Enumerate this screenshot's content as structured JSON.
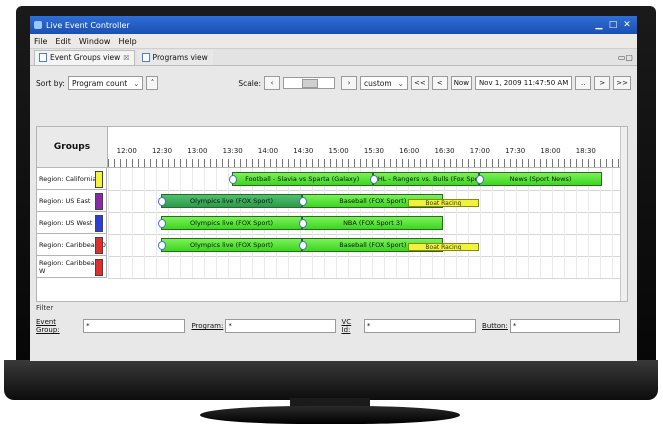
{
  "window": {
    "title": "Live Event Controller"
  },
  "menu": [
    "File",
    "Edit",
    "Window",
    "Help"
  ],
  "tabs": [
    {
      "label": "Event Groups view",
      "marker": "☒"
    },
    {
      "label": "Programs view"
    }
  ],
  "toolbar": {
    "sort_label": "Sort by:",
    "sort_value": "Program count",
    "scale_label": "Scale:",
    "scale_mode": "custom",
    "nav": [
      "<<",
      "<",
      "Now"
    ],
    "datetime": "Nov 1, 2009 11:47:50 AM",
    "nav_after": [
      "..",
      ">",
      ">>"
    ]
  },
  "grid": {
    "groups_header": "Groups",
    "times": [
      "12:00",
      "12:30",
      "13:00",
      "13:30",
      "14:00",
      "14:30",
      "15:00",
      "15:30",
      "16:00",
      "16:30",
      "17:00",
      "17:30",
      "18:00",
      "18:30"
    ],
    "rows": [
      {
        "label": "Region: California",
        "color": "#f4f43a",
        "events": [
          {
            "title": "Football - Slavia vs Sparta (Galaxy)",
            "kind": "green",
            "start": "13:30",
            "end": "15:30"
          },
          {
            "title": "NHL - Rangers vs. Bulls (Fox Spo",
            "kind": "green",
            "start": "15:30",
            "end": "17:00"
          },
          {
            "title": "News (Sport News)",
            "kind": "green",
            "start": "17:00",
            "end": "18:45"
          }
        ]
      },
      {
        "label": "Region: US East",
        "color": "#8a2aa8",
        "events": [
          {
            "title": "Olympics live (FOX Sport)",
            "kind": "darkgreen",
            "start": "12:30",
            "end": "14:30"
          },
          {
            "title": "Baseball (FOX Sport)",
            "kind": "green",
            "start": "14:30",
            "end": "16:30"
          },
          {
            "title": "Boat Racing",
            "kind": "yellow",
            "start": "16:00",
            "end": "17:00"
          }
        ]
      },
      {
        "label": "Region: US West",
        "color": "#2b3fd6",
        "events": [
          {
            "title": "Olympics live (FOX Sport)",
            "kind": "green",
            "start": "12:30",
            "end": "14:30"
          },
          {
            "title": "NBA (FOX Sport 3)",
            "kind": "green",
            "start": "14:30",
            "end": "16:30"
          }
        ]
      },
      {
        "label": "Region: Caribbean D",
        "color": "#e32d2d",
        "events": [
          {
            "title": "Olympics live (FOX Sport)",
            "kind": "green",
            "start": "12:30",
            "end": "14:30"
          },
          {
            "title": "Baseball (FOX Sport)",
            "kind": "green",
            "start": "14:30",
            "end": "16:30"
          },
          {
            "title": "Boat Racing",
            "kind": "yellow",
            "start": "16:00",
            "end": "17:00"
          }
        ]
      },
      {
        "label": "Region: Caribbean W",
        "color": "#e32d2d",
        "events": []
      }
    ]
  },
  "filter": {
    "title": "Filter",
    "fields": [
      {
        "label": "Event Group:",
        "value": "*"
      },
      {
        "label": "Program:",
        "value": "*"
      },
      {
        "label": "VC Id:",
        "value": "*"
      },
      {
        "label": "Button:",
        "value": "*"
      }
    ]
  }
}
